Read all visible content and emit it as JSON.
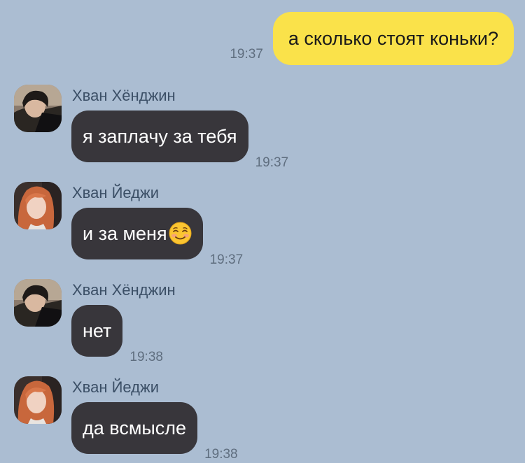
{
  "colors": {
    "background": "#abbdd2",
    "outgoing_bubble": "#fae24a",
    "incoming_bubble": "#38363b",
    "time_text": "#5f6e7f",
    "sender_text": "#3b4f66"
  },
  "outgoing": {
    "text": "а сколько стоят коньки?",
    "time": "19:37"
  },
  "messages": [
    {
      "sender": "Хван Хёнджин",
      "text": "я заплачу за тебя",
      "time": "19:37",
      "avatar_icon": "avatar-dark-hair-photo"
    },
    {
      "sender": "Хван Йеджи",
      "text": "и за меня",
      "emoji": "smiling-face-emoji",
      "time": "19:37",
      "avatar_icon": "avatar-red-hair-photo"
    },
    {
      "sender": "Хван Хёнджин",
      "text": "нет",
      "time": "19:38",
      "avatar_icon": "avatar-dark-hair-photo"
    },
    {
      "sender": "Хван Йеджи",
      "text": "да всмысле",
      "time": "19:38",
      "avatar_icon": "avatar-red-hair-photo"
    }
  ]
}
